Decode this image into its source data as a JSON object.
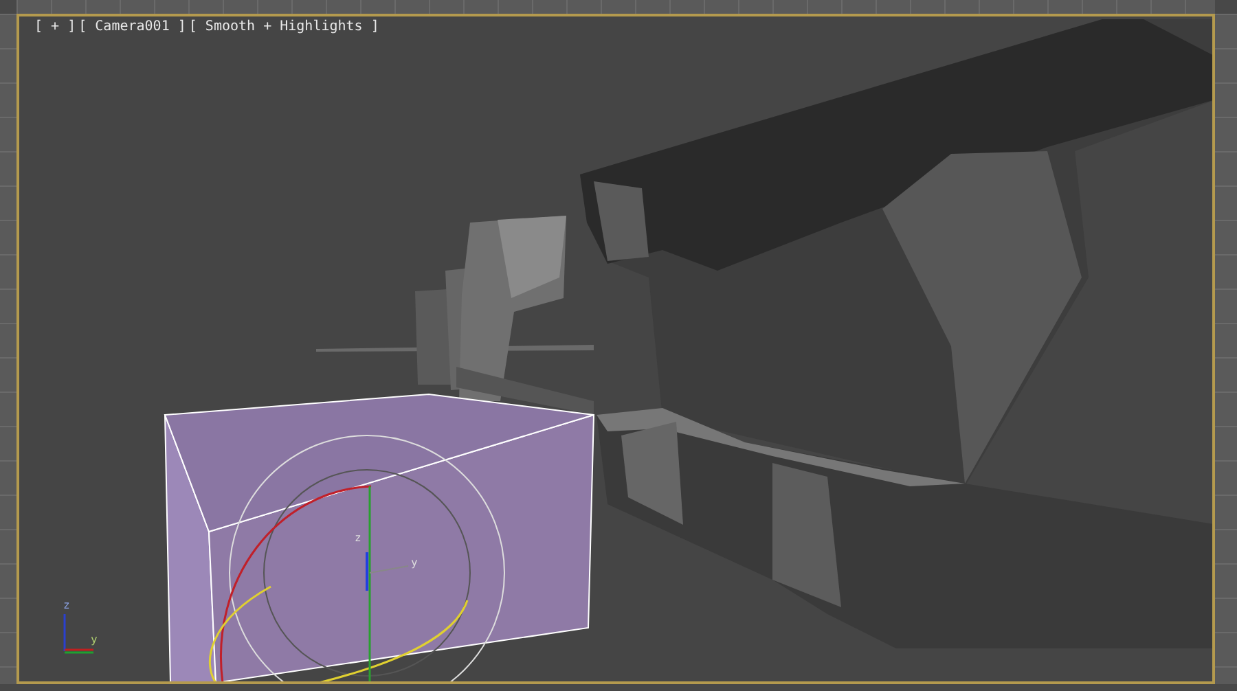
{
  "viewport": {
    "labels": [
      "[ + ]",
      "[ Camera001 ]",
      "[ Smooth + Highlights ]"
    ],
    "axis_tripod": {
      "labels": [
        "z",
        "y"
      ]
    },
    "gizmo": {
      "labels": [
        "z",
        "y"
      ]
    }
  }
}
